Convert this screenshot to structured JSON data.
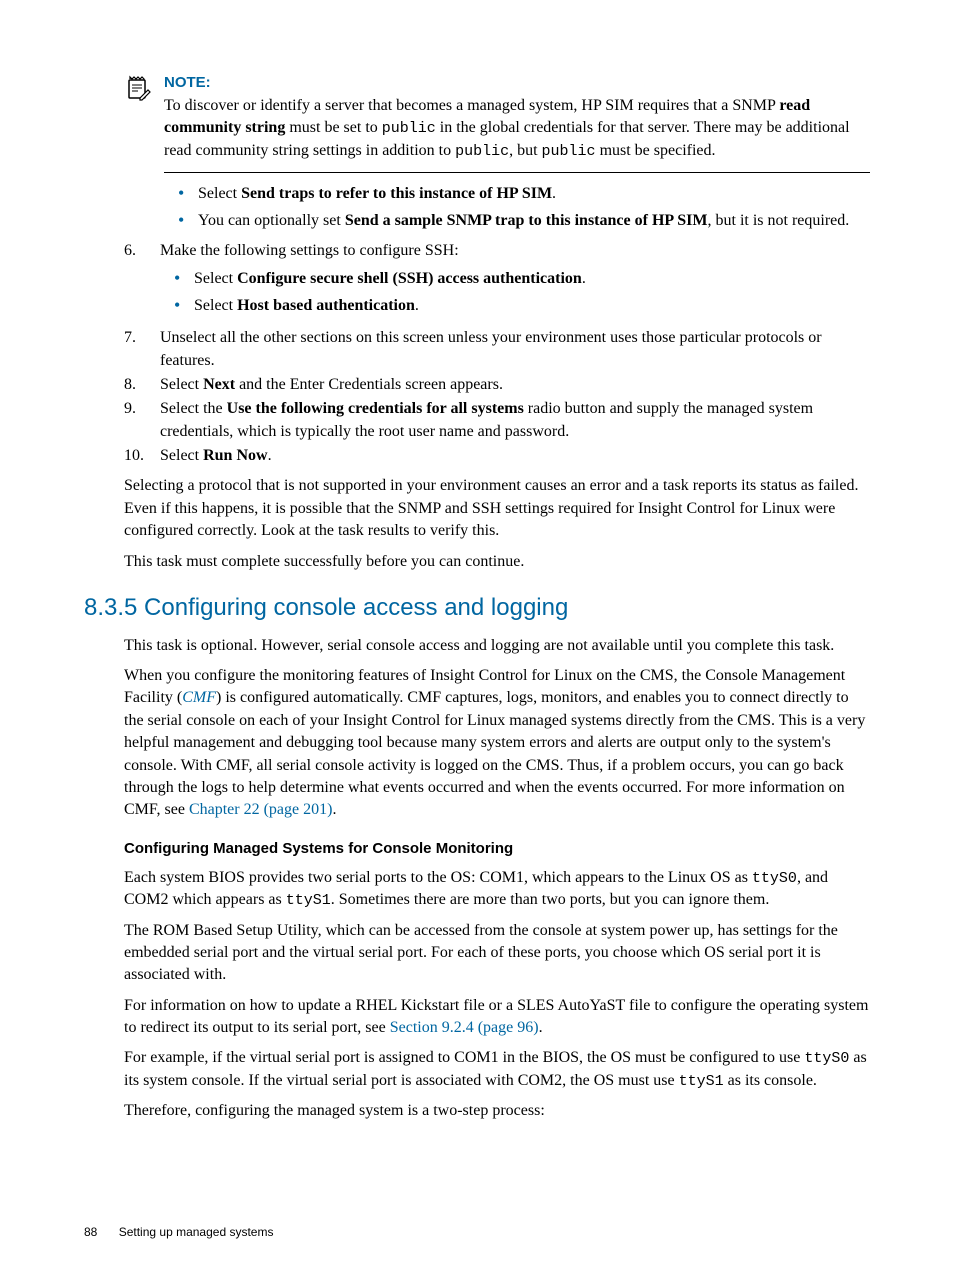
{
  "note": {
    "heading": "NOTE:",
    "body_pre": "To discover or identify a server that becomes a managed system, HP SIM requires that a SNMP ",
    "body_bold1": "read community string",
    "body_mid1": " must be set to ",
    "body_mono1": "public",
    "body_mid2": " in the global credentials for that server. There may be additional read community string settings in addition to ",
    "body_mono2": "public",
    "body_mid3": ", but ",
    "body_mono3": "public",
    "body_end": " must be specified."
  },
  "upper_bullets": {
    "b1_pre": "Select ",
    "b1_bold": "Send traps to refer to this instance of HP SIM",
    "b1_post": ".",
    "b2_pre": "You can optionally set ",
    "b2_bold": "Send a sample SNMP trap to this instance of HP SIM",
    "b2_post": ", but it is not required."
  },
  "steps": {
    "s6_num": "6.",
    "s6_text": "Make the following settings to configure SSH:",
    "s6_b1_pre": "Select ",
    "s6_b1_bold": "Configure secure shell (SSH) access authentication",
    "s6_b1_post": ".",
    "s6_b2_pre": "Select ",
    "s6_b2_bold": "Host based authentication",
    "s6_b2_post": ".",
    "s7_num": "7.",
    "s7_text": "Unselect all the other sections on this screen unless your environment uses those particular protocols or features.",
    "s8_num": "8.",
    "s8_pre": "Select ",
    "s8_bold": "Next",
    "s8_post": " and the Enter Credentials screen appears.",
    "s9_num": "9.",
    "s9_pre": "Select the ",
    "s9_bold": "Use the following credentials for all systems",
    "s9_post": " radio button and supply the managed system credentials, which is typically the root user name and password.",
    "s10_num": "10.",
    "s10_pre": "Select ",
    "s10_bold": "Run Now",
    "s10_post": "."
  },
  "para_after_steps_1": "Selecting a protocol that is not supported in your environment causes an error and a task reports its status as failed. Even if this happens, it is possible that the SNMP and SSH settings required for Insight Control for Linux were configured correctly. Look at the task results to verify this.",
  "para_after_steps_2": "This task must complete successfully before you can continue.",
  "section_title": "8.3.5 Configuring console access and logging",
  "section_p1": "This task is optional. However, serial console access and logging are not available until you complete this task.",
  "section_p2_pre": "When you configure the monitoring features of Insight Control for Linux on the CMS, the Console Management Facility (",
  "section_p2_link": "CMF",
  "section_p2_mid": ") is configured automatically. CMF captures, logs, monitors, and enables you to connect directly to the serial console on each of your Insight Control for Linux managed systems directly from the CMS. This is a very helpful management and debugging tool because many system errors and alerts are output only to the system's console. With CMF, all serial console activity is logged on the CMS. Thus, if a problem occurs, you can go back through the logs to help determine what events occurred and when the events occurred. For more information on CMF, see ",
  "section_p2_link2": "Chapter 22 (page 201)",
  "section_p2_end": ".",
  "sub_heading": "Configuring Managed Systems for Console Monitoring",
  "sub_p1_pre": "Each system BIOS provides two serial ports to the OS: COM1, which appears to the Linux OS as ",
  "sub_p1_mono1": "ttyS0",
  "sub_p1_mid": ", and COM2 which appears as ",
  "sub_p1_mono2": "ttyS1",
  "sub_p1_end": ". Sometimes there are more than two ports, but you can ignore them.",
  "sub_p2": "The ROM Based Setup Utility, which can be accessed from the console at system power up, has settings for the embedded serial port and the virtual serial port. For each of these ports, you choose which OS serial port it is associated with.",
  "sub_p3_pre": "For information on how to update a RHEL Kickstart file or a SLES AutoYaST file to configure the operating system to redirect its output to its serial port, see ",
  "sub_p3_link": "Section 9.2.4 (page 96)",
  "sub_p3_end": ".",
  "sub_p4_pre": "For example, if the virtual serial port is assigned to COM1 in the BIOS, the OS must be configured to use ",
  "sub_p4_mono1": "ttyS0",
  "sub_p4_mid": " as its system console. If the virtual serial port is associated with COM2, the OS must use ",
  "sub_p4_mono2": "ttyS1",
  "sub_p4_end": " as its console.",
  "sub_p5": "Therefore, configuring the managed system is a two-step process:",
  "footer": {
    "page_number": "88",
    "footer_text": "Setting up managed systems"
  }
}
